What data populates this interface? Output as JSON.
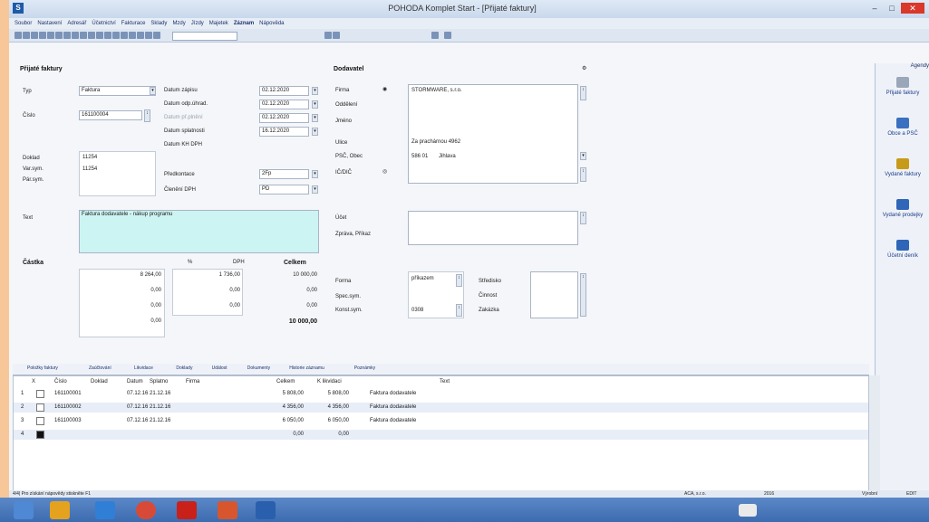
{
  "window": {
    "title": "POHODA Komplet Start - [Přijaté faktury]"
  },
  "menu": [
    "Soubor",
    "Nastavení",
    "Adresář",
    "Účetnictví",
    "Fakturace",
    "Sklady",
    "Mzdy",
    "Jízdy",
    "Majetek",
    "Záznam",
    "Nápověda"
  ],
  "menu_bold_index": 9,
  "agenda_panel": {
    "title": "Agendy",
    "items": [
      {
        "label": "Přijaté faktury",
        "icon": "invoice-in-icon",
        "color": "#9aa7b9"
      },
      {
        "label": "Obce a PSČ",
        "icon": "cities-icon",
        "color": "#3a70c0"
      },
      {
        "label": "Vydané faktury",
        "icon": "invoice-out-icon",
        "color": "#c89a1a"
      },
      {
        "label": "Vydané prodejky",
        "icon": "receipt-icon",
        "color": "#2f66b8"
      },
      {
        "label": "Účetní deník",
        "icon": "journal-icon",
        "color": "#2f66b8"
      }
    ]
  },
  "form": {
    "section_title": "Přijaté faktury",
    "typ_label": "Typ",
    "typ_value": "Faktura",
    "cislo_label": "Číslo",
    "cislo_value": "161100004",
    "datum_labels": [
      "Datum zápisu",
      "Datum odp.úhrad.",
      "Datum př.plnění",
      "Datum splatnosti",
      "Datum KH DPH"
    ],
    "datum_values": [
      "02.12.2020",
      "02.12.2020",
      "02.12.2020",
      "16.12.2020",
      ""
    ],
    "doklad_label": "Doklad",
    "doklad_value": "11254",
    "varsym_label": "Var.sym.",
    "varsym_value": "11254",
    "parsym_label": "Pár.sym.",
    "parsym_value": "",
    "predkontace_label": "Předkontace",
    "predkontace_value": "2Fp",
    "cleneni_label": "Členění DPH",
    "cleneni_value": "PD",
    "text_label": "Text",
    "text_value": "Faktura dodavatele - nákup programu",
    "castka_label": "Částka",
    "col_pct": "%",
    "col_dph": "DPH",
    "col_celkem": "Celkem",
    "amounts": [
      {
        "zaklad": "8 264,00",
        "dph": "1 736,00",
        "celkem": "10 000,00"
      },
      {
        "zaklad": "0,00",
        "dph": "0,00",
        "celkem": "0,00"
      },
      {
        "zaklad": "0,00",
        "dph": "0,00",
        "celkem": "0,00"
      },
      {
        "zaklad": "0,00",
        "dph": "",
        "celkem": ""
      }
    ],
    "total": "10 000,00"
  },
  "supplier": {
    "section_title": "Dodavatel",
    "firma_label": "Firma",
    "firma_value": "STORMWARE, s.r.o.",
    "oddeleni_label": "Oddělení",
    "jmeno_label": "Jméno",
    "ulice_label": "Ulice",
    "ulice_value": "Za prachárnou 4962",
    "psc_label": "PSČ, Obec",
    "psc_value": "586 01",
    "obec_value": "Jihlava",
    "ic_label": "IČ/DIČ",
    "ucet_label": "Účet",
    "sprava_label": "Zpráva, Příkaz",
    "forma_label": "Forma",
    "forma_value": "příkazem",
    "specsym_label": "Spec.sym.",
    "konstsym_label": "Konst.sym.",
    "konstsym_value": "0308",
    "stredisko_label": "Středisko",
    "cinnost_label": "Činnost",
    "zakazka_label": "Zakázka"
  },
  "tabs": [
    "Položky faktury",
    "Zaúčtování",
    "Likvidace",
    "Doklady",
    "Událost",
    "Dokumenty",
    "Historie záznamu",
    "Poznámky"
  ],
  "grid": {
    "headers": [
      "X",
      "Číslo",
      "Doklad",
      "Datum",
      "Splatno",
      "Firma",
      "Celkem",
      "K likvidaci",
      "Text"
    ],
    "rows": [
      {
        "n": "1",
        "cislo": "161100001",
        "datum": "07.12.16",
        "splatno": "21.12.16",
        "celkem": "5 808,00",
        "likv": "5 808,00",
        "text": "Faktura dodavatele"
      },
      {
        "n": "2",
        "cislo": "161100002",
        "datum": "07.12.16",
        "splatno": "21.12.16",
        "celkem": "4 356,00",
        "likv": "4 356,00",
        "text": "Faktura dodavatele"
      },
      {
        "n": "3",
        "cislo": "161100003",
        "datum": "07.12.16",
        "splatno": "21.12.16",
        "celkem": "6 050,00",
        "likv": "6 050,00",
        "text": "Faktura dodavatele"
      },
      {
        "n": "4",
        "cislo": "",
        "datum": "",
        "splatno": "",
        "celkem": "0,00",
        "likv": "0,00",
        "text": ""
      }
    ]
  },
  "status": {
    "left": "4/4| Pro získání nápovědy stiskněte F1",
    "company": "ACA, s.r.o.",
    "year": "2016",
    "user": "Výrobní",
    "mode": "EDIT"
  }
}
